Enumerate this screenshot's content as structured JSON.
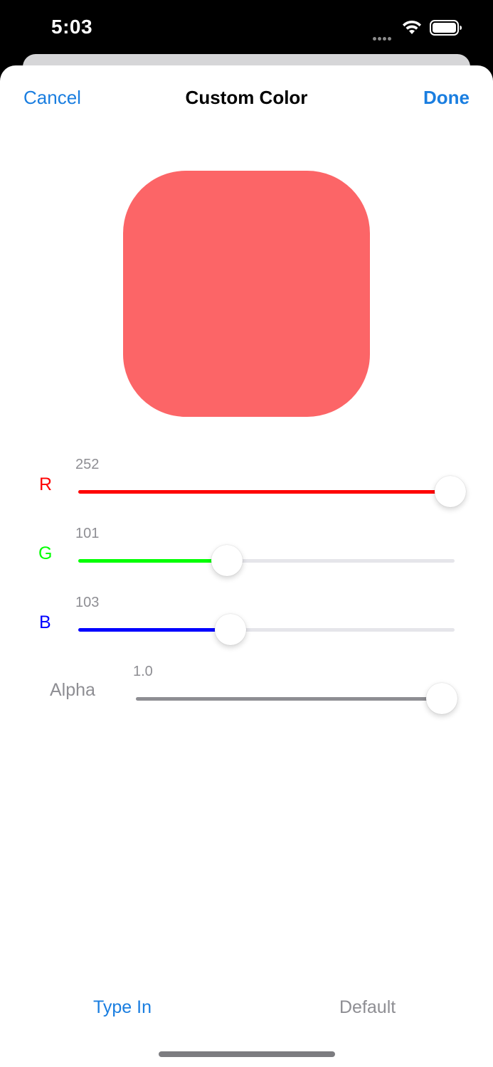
{
  "status": {
    "time": "5:03"
  },
  "nav": {
    "cancel_label": "Cancel",
    "title": "Custom Color",
    "done_label": "Done"
  },
  "preview": {
    "color": "#fc6567"
  },
  "sliders": {
    "r": {
      "label": "R",
      "value": "252",
      "fraction": 0.988,
      "color": "#ff0000"
    },
    "g": {
      "label": "G",
      "value": "101",
      "fraction": 0.396,
      "color": "#00ff00"
    },
    "b": {
      "label": "B",
      "value": "103",
      "fraction": 0.404,
      "color": "#0000ff"
    },
    "alpha": {
      "label": "Alpha",
      "value": "1.0",
      "fraction": 1.0,
      "color": "#8e8e93"
    }
  },
  "footer": {
    "type_in_label": "Type In",
    "default_label": "Default"
  },
  "colors": {
    "accent": "#1a7ee0",
    "secondary_text": "#8e8e93"
  }
}
